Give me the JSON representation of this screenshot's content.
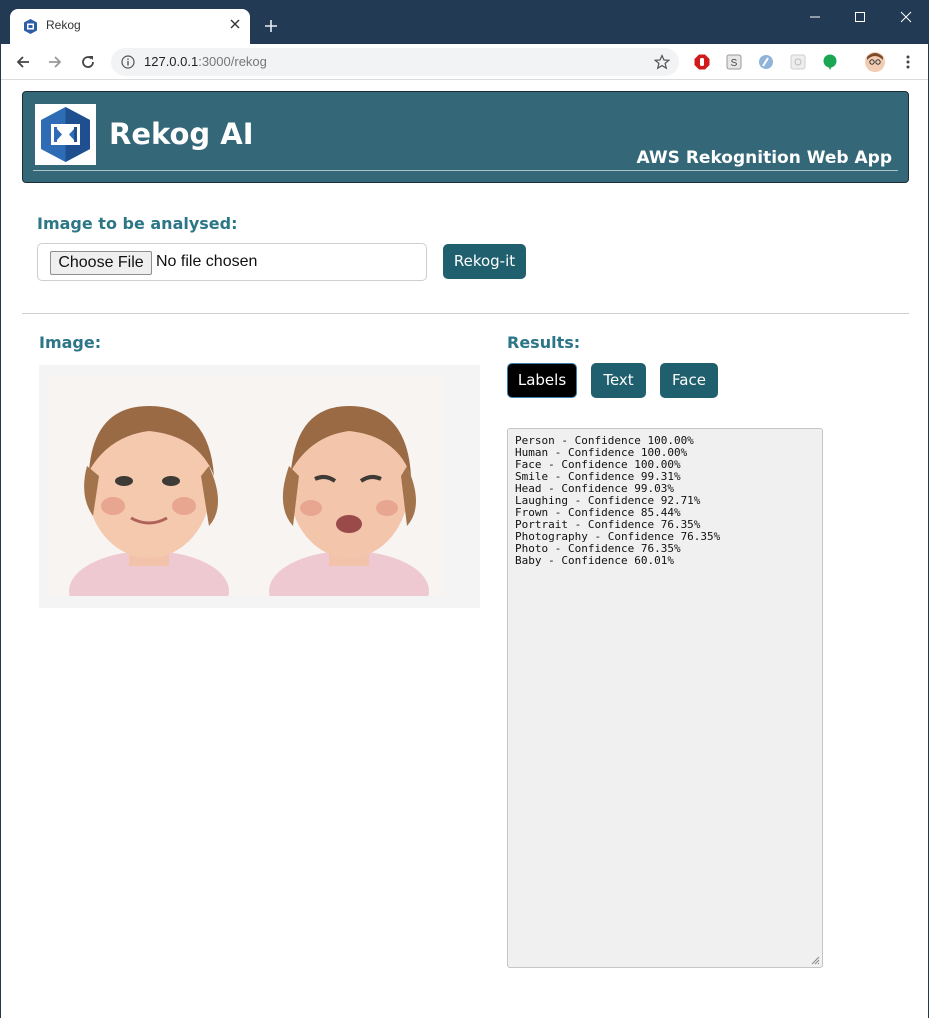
{
  "browser": {
    "tab_title": "Rekog",
    "url_host": "127.0.0.1",
    "url_rest": ":3000/rekog"
  },
  "header": {
    "title": "Rekog AI",
    "subtitle": "AWS Rekognition Web App"
  },
  "upload": {
    "label": "Image to be analysed:",
    "choose_label": "Choose File",
    "status": "No file chosen",
    "submit_label": "Rekog-it"
  },
  "image_panel": {
    "label": "Image:"
  },
  "results_panel": {
    "label": "Results:",
    "tabs": [
      {
        "label": "Labels",
        "active": true
      },
      {
        "label": "Text",
        "active": false
      },
      {
        "label": "Face",
        "active": false
      }
    ],
    "lines": [
      "Person - Confidence 100.00%",
      "Human - Confidence 100.00%",
      "Face - Confidence 100.00%",
      "Smile - Confidence 99.31%",
      "Head - Confidence 99.03%",
      "Laughing - Confidence 92.71%",
      "Frown - Confidence 85.44%",
      "Portrait - Confidence 76.35%",
      "Photography - Confidence 76.35%",
      "Photo - Confidence 76.35%",
      "Baby - Confidence 60.01%"
    ]
  },
  "colors": {
    "header_bg": "#346878",
    "accent": "#205f6e",
    "label_text": "#2c7687",
    "titlebar": "#233a55"
  },
  "icons": [
    "aws-favicon-icon",
    "close-tab-icon",
    "new-tab-icon",
    "minimize-icon",
    "maximize-icon",
    "close-window-icon",
    "back-icon",
    "forward-icon",
    "reload-icon",
    "site-info-icon",
    "bookmark-star-icon",
    "extension-icons",
    "profile-avatar",
    "menu-kebab-icon",
    "rekognition-logo"
  ]
}
